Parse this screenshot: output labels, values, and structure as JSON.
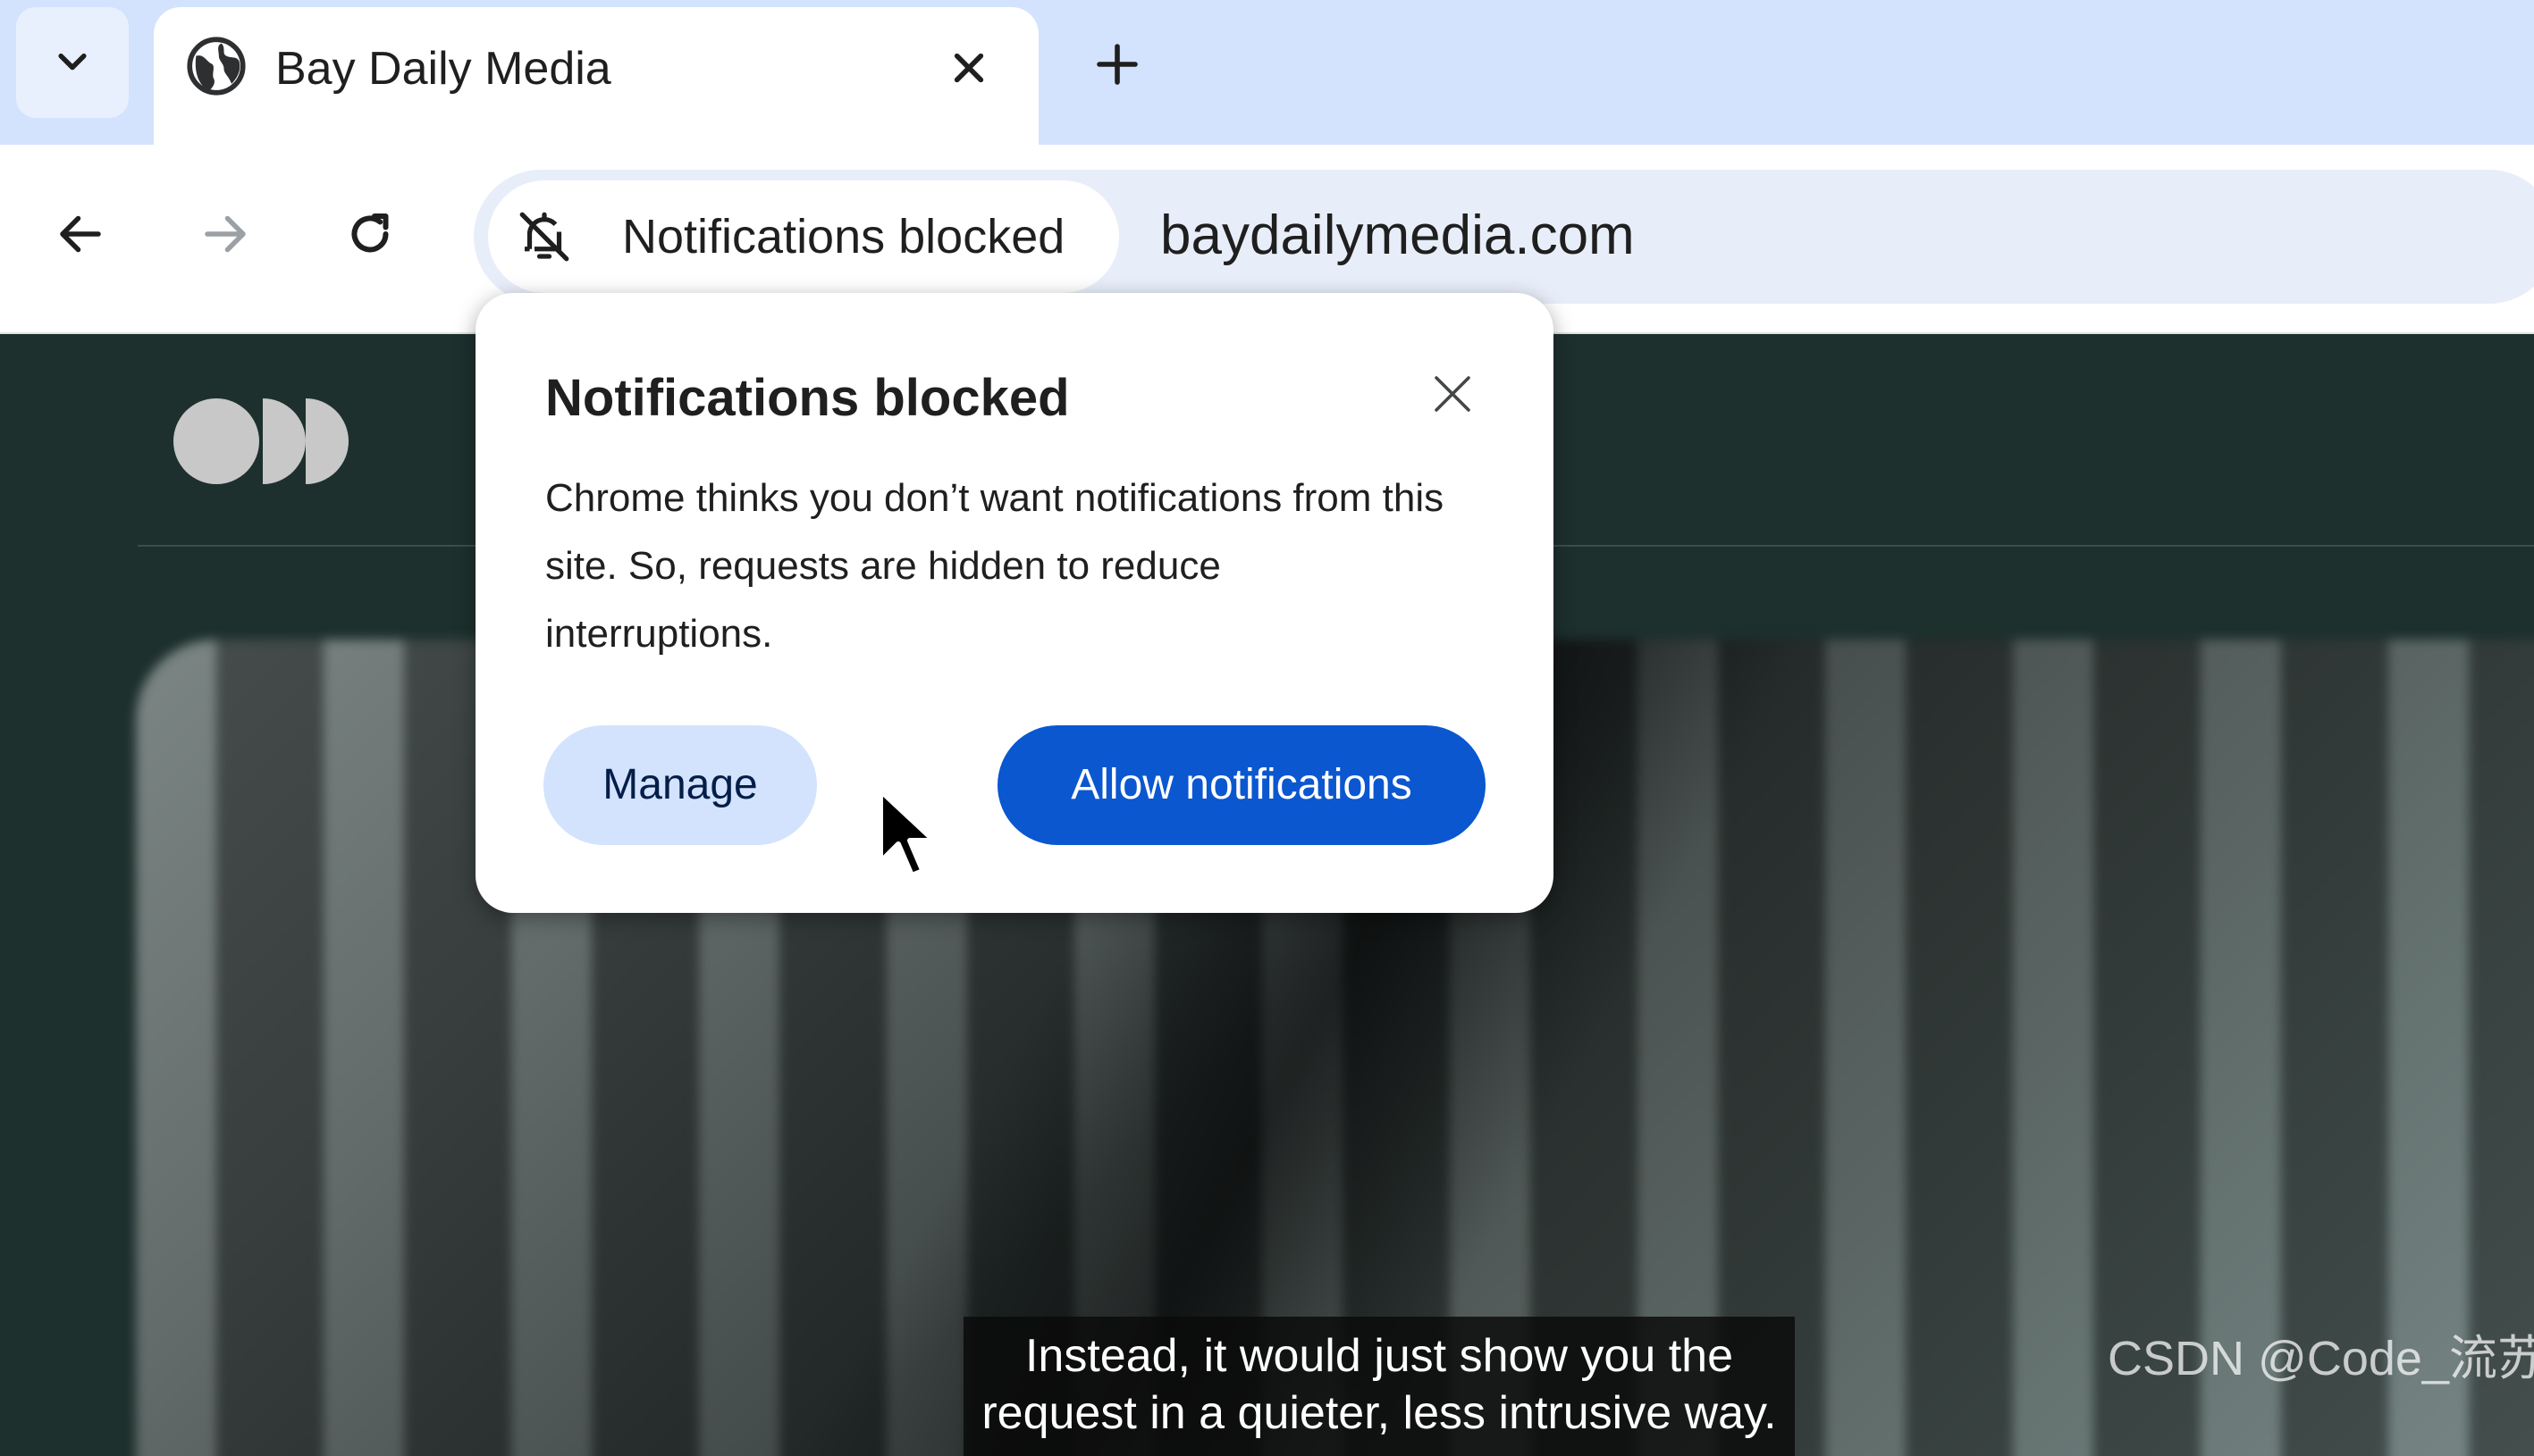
{
  "browser": {
    "tab_search_icon": "chevron-down-icon",
    "tab": {
      "title": "Bay Daily Media",
      "favicon": "globe-icon",
      "close_icon": "close-icon"
    },
    "new_tab_icon": "plus-icon",
    "toolbar": {
      "back_icon": "arrow-left-icon",
      "forward_icon": "arrow-right-icon",
      "reload_icon": "reload-icon"
    },
    "omnibox": {
      "chip_label": "Notifications blocked",
      "chip_icon": "bell-off-icon",
      "url": "baydailymedia.com"
    }
  },
  "popup": {
    "title": "Notifications blocked",
    "body": "Chrome thinks you don’t want notifications from this site. So, requests are hidden to reduce interruptions.",
    "manage_label": "Manage",
    "allow_label": "Allow notifications",
    "close_icon": "close-icon"
  },
  "page": {
    "logo_icon": "site-logo-icon"
  },
  "caption": {
    "line1": "Instead, it would just show you the",
    "line2": "request in a quieter, less intrusive way."
  },
  "watermark": "CSDN @Code_流苏",
  "colors": {
    "tabstrip_bg": "#d3e3fd",
    "primary_button": "#0b57d0",
    "tonal_button": "#d3e3fd",
    "page_bg": "#1d302d"
  }
}
